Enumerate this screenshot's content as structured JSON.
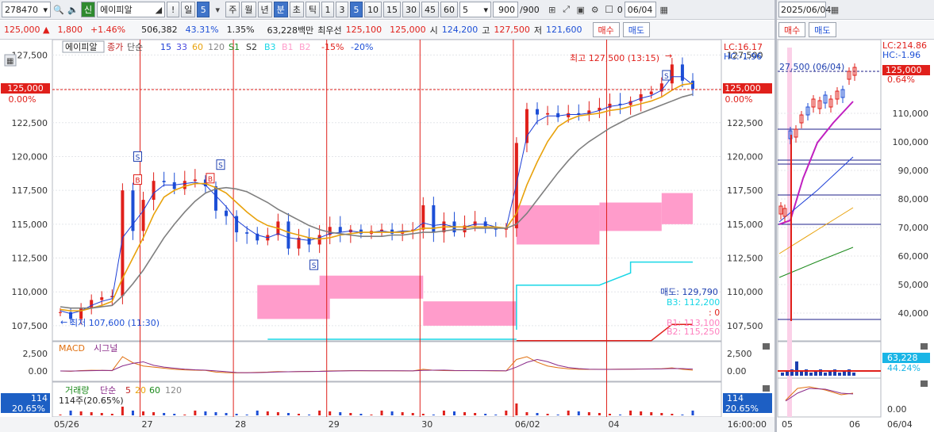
{
  "toolbar": {
    "code": "278470",
    "badge": "신",
    "name": "에이피알",
    "excl": "!",
    "periods": [
      "일",
      "5",
      "주",
      "월",
      "년",
      "분",
      "초",
      "틱"
    ],
    "minutes": [
      "1",
      "3",
      "5",
      "10",
      "15",
      "30",
      "45",
      "60"
    ],
    "interval_value": "5",
    "count": "900",
    "count_total": "/900",
    "date": "06/04",
    "checkbox_label": "0"
  },
  "quote": {
    "price": "125,000",
    "arrow": "▲",
    "change": "1,800",
    "change_pct": "+1.46%",
    "volume": "506,382",
    "vol_ratio": "43.31%",
    "turnover_rate": "1.35%",
    "amount": "63,228백만",
    "best_label": "최우선",
    "best_ask": "125,100",
    "best_bid": "125,000",
    "open_label": "시",
    "open": "124,200",
    "high_label": "고",
    "high": "127,500",
    "low_label": "저",
    "low": "121,600",
    "buy_btn": "매수",
    "sell_btn": "매도"
  },
  "right_panel": {
    "date": "2025/06/04",
    "buy_btn": "매수",
    "sell_btn": "매도",
    "lc": "LC:214.86",
    "hc": "HC:-1.96",
    "price_tag": "125,000",
    "pct_tag": "0.64%",
    "note": "27,500 (06/04)",
    "y_ticks": [
      "110,000",
      "100,000",
      "90,000",
      "80,000",
      "70,000",
      "60,000",
      "50,000",
      "40,000"
    ],
    "vol_tag": "63,228",
    "vol_pct": "44.24%",
    "macd_tick": "0.00",
    "x_labels": [
      "05",
      "06",
      "06/04"
    ]
  },
  "legend": {
    "name": "에이피알",
    "items": [
      "종가",
      "단순",
      "15",
      "33",
      "60",
      "120",
      "S1",
      "S2",
      "B3",
      "B1",
      "B2",
      "-15%",
      "-20%"
    ],
    "lc": "LC:16.17",
    "hc": "HC:-1.96"
  },
  "annotations": {
    "high": "최고 127,500 (13:15)",
    "low": "최저 107,600 (11:30)",
    "sell_info": "매도: 129,790",
    "b3": "B3: 112,200",
    "zero": ": 0",
    "b1": "B1: 113,100",
    "b2": "B2: 115,250",
    "cur_price": "125,000",
    "cur_pct": "0.00%"
  },
  "macd": {
    "label": "MACD",
    "signal": "시그널",
    "ticks": [
      "2,500",
      "0.00"
    ]
  },
  "volume_pane": {
    "label": "거래량",
    "ma_label": "단순",
    "periods": [
      "5",
      "20",
      "60",
      "120"
    ],
    "current": "114주(20.65%)",
    "tag": "114",
    "pct": "20.65%"
  },
  "time_label": "16:00:00",
  "colors": {
    "up": "#e0201b",
    "down": "#1d4fd6",
    "ma5": "#1d3fd6",
    "ma20": "#e8a20c",
    "ma60": "#7f7f7f",
    "band": "#ff9ccb",
    "cyan": "#19d7e6"
  },
  "chart_data": {
    "type": "line",
    "title": "",
    "x_labels": [
      "05/26",
      "27",
      "28",
      "29",
      "30",
      "06/02",
      "04"
    ],
    "y_ticks": [
      127500,
      125000,
      122500,
      120000,
      117500,
      115000,
      112500,
      110000,
      107500
    ],
    "ylim": [
      106500,
      128400
    ],
    "series": [
      {
        "name": "종가",
        "values": [
          108500,
          108000,
          108800,
          109400,
          109600,
          109700,
          117500,
          114500,
          116800,
          118200,
          118100,
          117600,
          118200,
          118300,
          117800,
          116000,
          115600,
          114400,
          114300,
          113800,
          114200,
          115200,
          113200,
          114000,
          113500,
          114200,
          114800,
          114400,
          114600,
          114300,
          114500,
          114600,
          114300,
          114500,
          114600,
          116400,
          114400,
          115200,
          114400,
          114900,
          115200,
          114800,
          114600,
          114700,
          121000,
          123500,
          123100,
          123200,
          122900,
          123200,
          123100,
          123400,
          123600,
          123900,
          123800,
          124100,
          124600,
          124800,
          125400,
          126800,
          125600,
          125000
        ]
      },
      {
        "name": "5",
        "values": [
          108600,
          108400,
          108600,
          109000,
          109300,
          109500,
          114000,
          115000,
          116000,
          117300,
          117900,
          117900,
          118000,
          118100,
          117900,
          117100,
          116300,
          115300,
          114700,
          114200,
          114000,
          114300,
          114000,
          113900,
          113800,
          114000,
          114300,
          114400,
          114500,
          114400,
          114400,
          114500,
          114400,
          114500,
          114500,
          115100,
          114900,
          115000,
          114800,
          114800,
          115000,
          115000,
          114800,
          114700,
          118000,
          121500,
          122600,
          123000,
          123000,
          123100,
          123100,
          123200,
          123400,
          123700,
          123800,
          124000,
          124300,
          124500,
          124900,
          125900,
          125900,
          125300
        ]
      },
      {
        "name": "20",
        "values": [
          108700,
          108600,
          108600,
          108800,
          109000,
          109300,
          111000,
          112500,
          114000,
          115700,
          117000,
          117500,
          117800,
          118000,
          118000,
          117700,
          117300,
          116600,
          115900,
          115300,
          114900,
          114700,
          114400,
          114200,
          114000,
          113900,
          114000,
          114200,
          114300,
          114400,
          114400,
          114400,
          114400,
          114400,
          114500,
          114700,
          114700,
          114800,
          114800,
          114800,
          114800,
          114800,
          114800,
          114700,
          115800,
          117900,
          119600,
          121100,
          122200,
          122700,
          123000,
          123100,
          123200,
          123400,
          123500,
          123700,
          123900,
          124100,
          124400,
          124900,
          125300,
          125400
        ]
      },
      {
        "name": "60",
        "values": [
          108900,
          108800,
          108800,
          108800,
          108900,
          109000,
          109700,
          110600,
          111600,
          112800,
          114000,
          115000,
          115900,
          116700,
          117300,
          117600,
          117700,
          117600,
          117400,
          117000,
          116600,
          116100,
          115700,
          115300,
          114900,
          114600,
          114400,
          114300,
          114200,
          114100,
          114100,
          114100,
          114200,
          114200,
          114300,
          114400,
          114400,
          114500,
          114600,
          114600,
          114700,
          114700,
          114700,
          114700,
          115000,
          115800,
          116800,
          117800,
          118800,
          119700,
          120500,
          121100,
          121600,
          122100,
          122500,
          122900,
          123200,
          123500,
          123800,
          124100,
          124400,
          124600
        ]
      }
    ],
    "bands": [
      {
        "name": "B3",
        "value": 112200
      },
      {
        "name": "B1",
        "value": 113100
      },
      {
        "name": "B2",
        "value": 115250
      }
    ],
    "signals": [
      {
        "type": "S",
        "label": "S"
      },
      {
        "type": "B",
        "label": "B"
      },
      {
        "type": "B",
        "label": "B"
      },
      {
        "type": "S",
        "label": "S"
      },
      {
        "type": "S",
        "label": "S"
      },
      {
        "type": "S",
        "label": "S"
      }
    ],
    "macd_values": [
      0,
      -50,
      80,
      120,
      100,
      60,
      2600,
      1500,
      900,
      700,
      500,
      300,
      200,
      150,
      100,
      -200,
      -300,
      -350,
      -300,
      -250,
      -200,
      -100,
      -150,
      -100,
      -80,
      -60,
      20,
      40,
      60,
      40,
      30,
      40,
      30,
      20,
      20,
      300,
      120,
      80,
      60,
      50,
      70,
      50,
      20,
      10,
      2100,
      2600,
      1600,
      900,
      600,
      400,
      300,
      280,
      300,
      310,
      320,
      330,
      360,
      380,
      420,
      560,
      300,
      150
    ]
  }
}
